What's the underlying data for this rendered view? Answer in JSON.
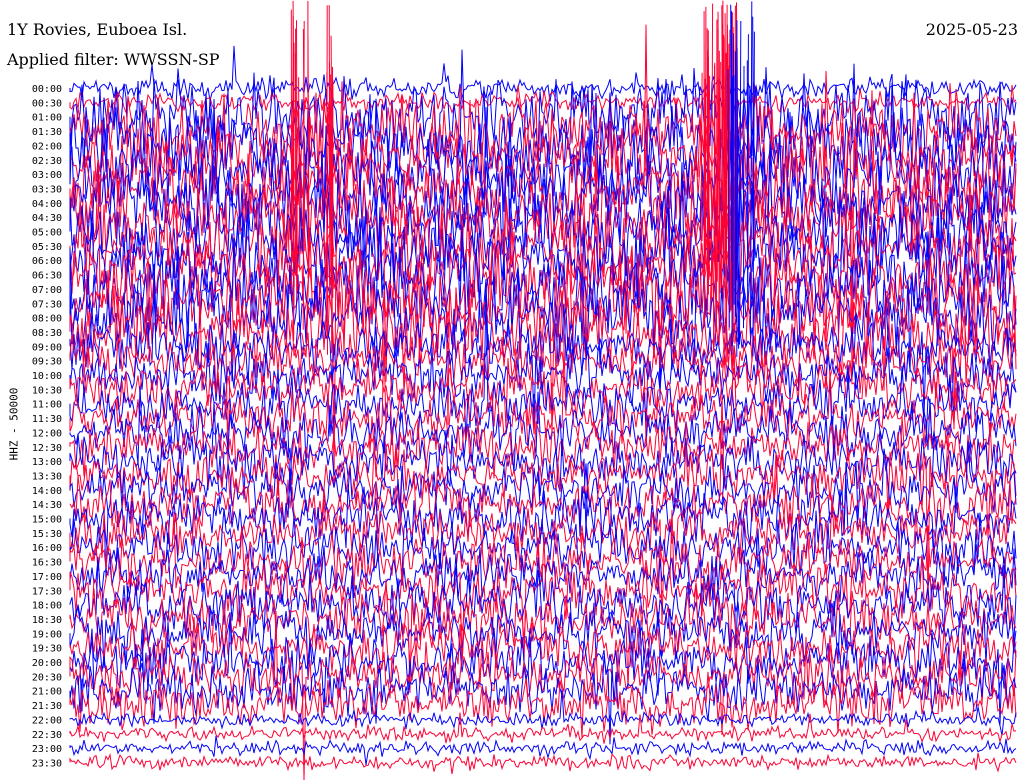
{
  "header": {
    "station": "1Y Rovies, Euboea Isl.",
    "filter": "Applied filter: WWSSN-SP",
    "date": "2025-05-23"
  },
  "chart_data": {
    "type": "line",
    "subtype": "helicorder",
    "title": "1Y Rovies, Euboea Isl.",
    "subtitle": "Applied filter: WWSSN-SP",
    "date": "2025-05-23",
    "ylabel": "HHZ - 50000",
    "row_interval_minutes": 30,
    "tick_labels": [
      "00:00",
      "00:30",
      "01:00",
      "01:30",
      "02:00",
      "02:30",
      "03:00",
      "03:30",
      "04:00",
      "04:30",
      "05:00",
      "05:30",
      "06:00",
      "06:30",
      "07:00",
      "07:30",
      "08:00",
      "08:30",
      "09:00",
      "09:30",
      "10:00",
      "10:30",
      "11:00",
      "11:30",
      "12:00",
      "12:30",
      "13:00",
      "13:30",
      "14:00",
      "14:30",
      "15:00",
      "15:30",
      "16:00",
      "16:30",
      "17:00",
      "17:30",
      "18:00",
      "18:30",
      "19:00",
      "19:30",
      "20:00",
      "20:30",
      "21:00",
      "21:30",
      "22:00",
      "22:30",
      "23:00",
      "23:30"
    ],
    "trace_colors": [
      "#0000ff",
      "#ff0033"
    ],
    "grid": false,
    "legend": "none"
  }
}
